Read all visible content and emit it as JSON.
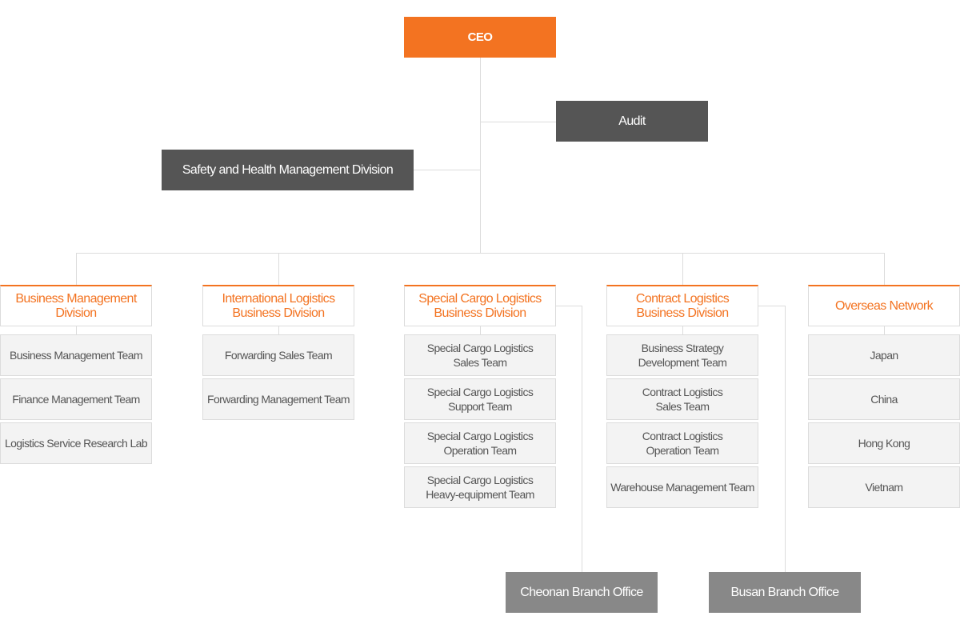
{
  "colors": {
    "accent": "#f37321",
    "dark_box": "#555555",
    "branch_box": "#888888",
    "team_bg": "#f3f3f3",
    "line": "#dcdcdc"
  },
  "ceo": "CEO",
  "audit": "Audit",
  "safety": "Safety and Health Management Division",
  "divisions": [
    {
      "name": "Business Management\nDivision",
      "teams": [
        "Business Management Team",
        "Finance Management Team",
        "Logistics Service Research Lab"
      ]
    },
    {
      "name": "International Logistics\nBusiness Division",
      "teams": [
        "Forwarding Sales Team",
        "Forwarding Management Team"
      ]
    },
    {
      "name": "Special Cargo Logistics\nBusiness Division",
      "teams": [
        "Special Cargo Logistics\nSales Team",
        "Special Cargo Logistics\nSupport Team",
        "Special Cargo Logistics\nOperation Team",
        "Special Cargo Logistics\nHeavy-equipment Team"
      ],
      "branch": "Cheonan Branch Office"
    },
    {
      "name": "Contract Logistics\nBusiness Division",
      "teams": [
        "Business Strategy\nDevelopment Team",
        "Contract Logistics\nSales Team",
        "Contract Logistics\nOperation Team",
        "Warehouse Management Team"
      ],
      "branch": "Busan Branch Office"
    },
    {
      "name": "Overseas Network",
      "teams": [
        "Japan",
        "China",
        "Hong Kong",
        "Vietnam"
      ]
    }
  ]
}
